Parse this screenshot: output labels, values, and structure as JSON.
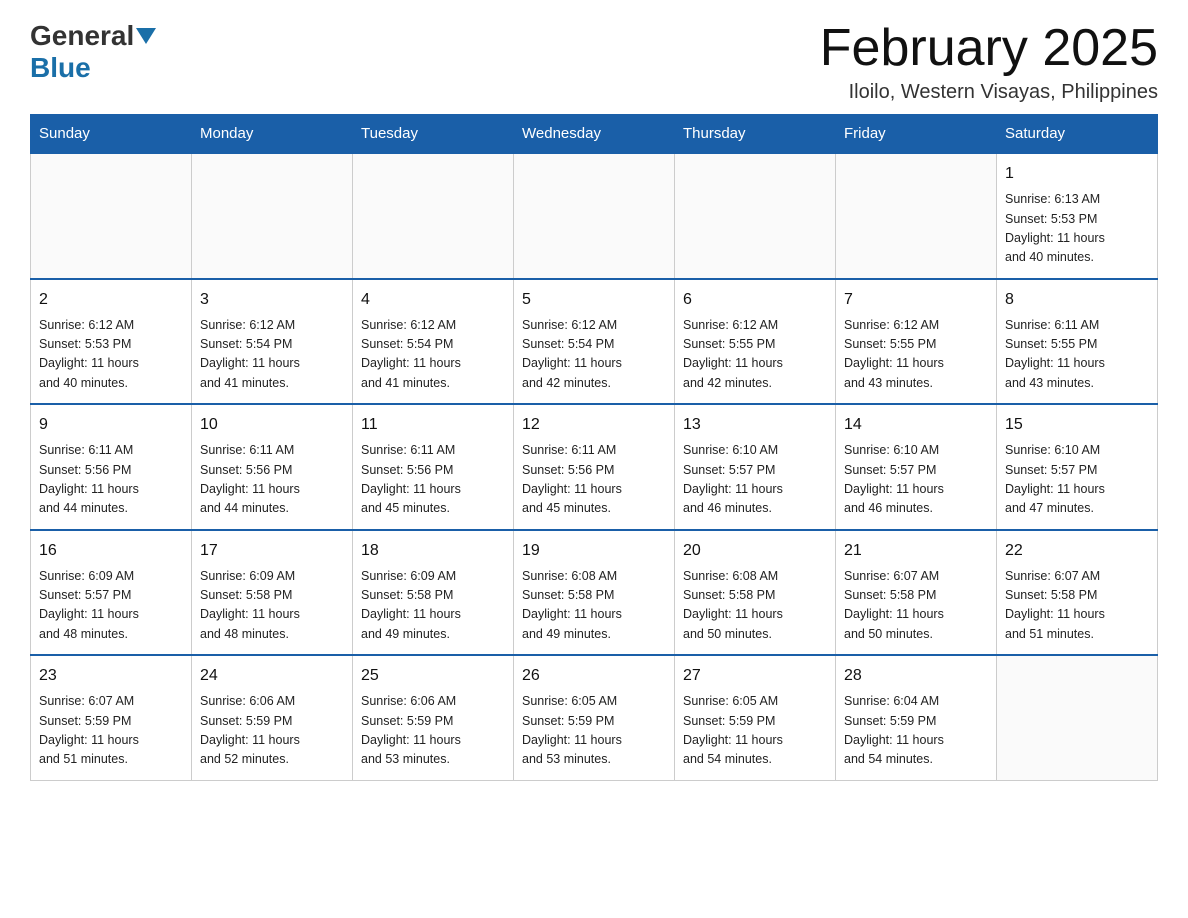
{
  "logo": {
    "general": "General",
    "blue": "Blue"
  },
  "header": {
    "title": "February 2025",
    "subtitle": "Iloilo, Western Visayas, Philippines"
  },
  "weekdays": [
    "Sunday",
    "Monday",
    "Tuesday",
    "Wednesday",
    "Thursday",
    "Friday",
    "Saturday"
  ],
  "weeks": [
    [
      {
        "day": "",
        "info": ""
      },
      {
        "day": "",
        "info": ""
      },
      {
        "day": "",
        "info": ""
      },
      {
        "day": "",
        "info": ""
      },
      {
        "day": "",
        "info": ""
      },
      {
        "day": "",
        "info": ""
      },
      {
        "day": "1",
        "info": "Sunrise: 6:13 AM\nSunset: 5:53 PM\nDaylight: 11 hours\nand 40 minutes."
      }
    ],
    [
      {
        "day": "2",
        "info": "Sunrise: 6:12 AM\nSunset: 5:53 PM\nDaylight: 11 hours\nand 40 minutes."
      },
      {
        "day": "3",
        "info": "Sunrise: 6:12 AM\nSunset: 5:54 PM\nDaylight: 11 hours\nand 41 minutes."
      },
      {
        "day": "4",
        "info": "Sunrise: 6:12 AM\nSunset: 5:54 PM\nDaylight: 11 hours\nand 41 minutes."
      },
      {
        "day": "5",
        "info": "Sunrise: 6:12 AM\nSunset: 5:54 PM\nDaylight: 11 hours\nand 42 minutes."
      },
      {
        "day": "6",
        "info": "Sunrise: 6:12 AM\nSunset: 5:55 PM\nDaylight: 11 hours\nand 42 minutes."
      },
      {
        "day": "7",
        "info": "Sunrise: 6:12 AM\nSunset: 5:55 PM\nDaylight: 11 hours\nand 43 minutes."
      },
      {
        "day": "8",
        "info": "Sunrise: 6:11 AM\nSunset: 5:55 PM\nDaylight: 11 hours\nand 43 minutes."
      }
    ],
    [
      {
        "day": "9",
        "info": "Sunrise: 6:11 AM\nSunset: 5:56 PM\nDaylight: 11 hours\nand 44 minutes."
      },
      {
        "day": "10",
        "info": "Sunrise: 6:11 AM\nSunset: 5:56 PM\nDaylight: 11 hours\nand 44 minutes."
      },
      {
        "day": "11",
        "info": "Sunrise: 6:11 AM\nSunset: 5:56 PM\nDaylight: 11 hours\nand 45 minutes."
      },
      {
        "day": "12",
        "info": "Sunrise: 6:11 AM\nSunset: 5:56 PM\nDaylight: 11 hours\nand 45 minutes."
      },
      {
        "day": "13",
        "info": "Sunrise: 6:10 AM\nSunset: 5:57 PM\nDaylight: 11 hours\nand 46 minutes."
      },
      {
        "day": "14",
        "info": "Sunrise: 6:10 AM\nSunset: 5:57 PM\nDaylight: 11 hours\nand 46 minutes."
      },
      {
        "day": "15",
        "info": "Sunrise: 6:10 AM\nSunset: 5:57 PM\nDaylight: 11 hours\nand 47 minutes."
      }
    ],
    [
      {
        "day": "16",
        "info": "Sunrise: 6:09 AM\nSunset: 5:57 PM\nDaylight: 11 hours\nand 48 minutes."
      },
      {
        "day": "17",
        "info": "Sunrise: 6:09 AM\nSunset: 5:58 PM\nDaylight: 11 hours\nand 48 minutes."
      },
      {
        "day": "18",
        "info": "Sunrise: 6:09 AM\nSunset: 5:58 PM\nDaylight: 11 hours\nand 49 minutes."
      },
      {
        "day": "19",
        "info": "Sunrise: 6:08 AM\nSunset: 5:58 PM\nDaylight: 11 hours\nand 49 minutes."
      },
      {
        "day": "20",
        "info": "Sunrise: 6:08 AM\nSunset: 5:58 PM\nDaylight: 11 hours\nand 50 minutes."
      },
      {
        "day": "21",
        "info": "Sunrise: 6:07 AM\nSunset: 5:58 PM\nDaylight: 11 hours\nand 50 minutes."
      },
      {
        "day": "22",
        "info": "Sunrise: 6:07 AM\nSunset: 5:58 PM\nDaylight: 11 hours\nand 51 minutes."
      }
    ],
    [
      {
        "day": "23",
        "info": "Sunrise: 6:07 AM\nSunset: 5:59 PM\nDaylight: 11 hours\nand 51 minutes."
      },
      {
        "day": "24",
        "info": "Sunrise: 6:06 AM\nSunset: 5:59 PM\nDaylight: 11 hours\nand 52 minutes."
      },
      {
        "day": "25",
        "info": "Sunrise: 6:06 AM\nSunset: 5:59 PM\nDaylight: 11 hours\nand 53 minutes."
      },
      {
        "day": "26",
        "info": "Sunrise: 6:05 AM\nSunset: 5:59 PM\nDaylight: 11 hours\nand 53 minutes."
      },
      {
        "day": "27",
        "info": "Sunrise: 6:05 AM\nSunset: 5:59 PM\nDaylight: 11 hours\nand 54 minutes."
      },
      {
        "day": "28",
        "info": "Sunrise: 6:04 AM\nSunset: 5:59 PM\nDaylight: 11 hours\nand 54 minutes."
      },
      {
        "day": "",
        "info": ""
      }
    ]
  ]
}
